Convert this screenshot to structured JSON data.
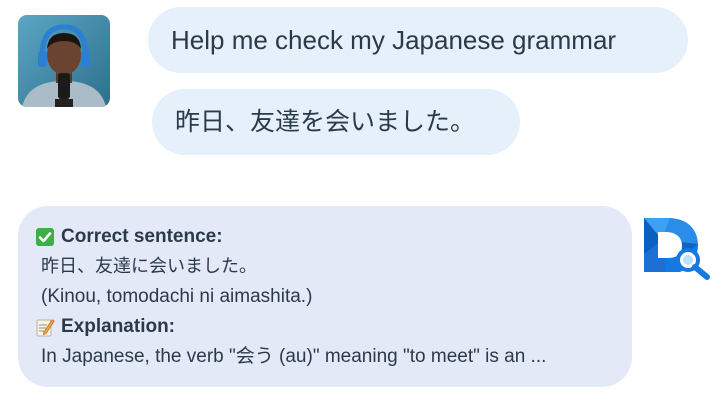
{
  "user": {
    "avatar_icon": "user-avatar-photo",
    "messages": [
      "Help me check my Japanese grammar",
      "昨日、友達を会いました。"
    ]
  },
  "assistant": {
    "logo_icon": "d-magnifier-logo-icon",
    "correct_icon": "check-mark-icon",
    "correct_heading": "Correct sentence:",
    "correct_japanese": "昨日、友達に会いました。",
    "correct_romaji": "(Kinou, tomodachi ni aimashita.)",
    "explanation_icon": "memo-pencil-icon",
    "explanation_heading": "Explanation:",
    "explanation_text": "In Japanese, the verb \"会う (au)\" meaning \"to meet\" is an ..."
  },
  "colors": {
    "user_bubble": "#e5f0fa",
    "assistant_bubble": "#e4e9f8",
    "text": "#2b3a4a",
    "check_green": "#3fae49",
    "logo_blue": "#1479e0"
  }
}
